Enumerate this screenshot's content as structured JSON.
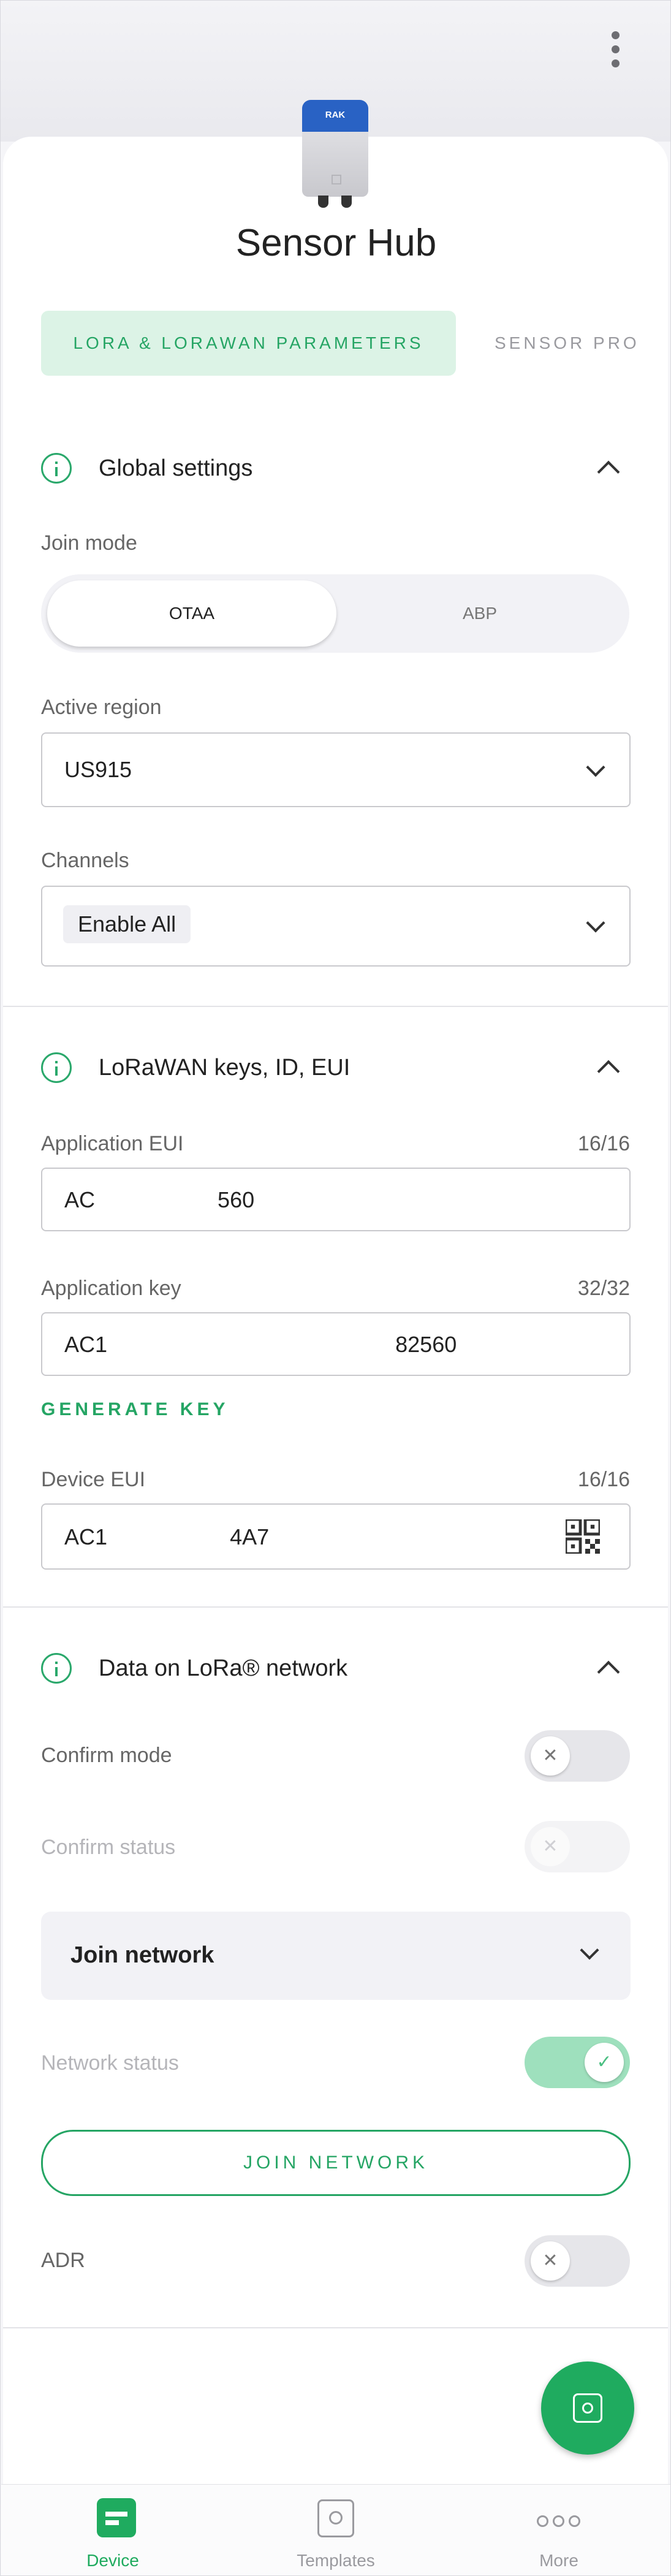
{
  "header": {
    "device_name": "Sensor Hub",
    "device_brand": "RAK"
  },
  "tabs": [
    {
      "label": "LORA & LORAWAN PARAMETERS",
      "active": true
    },
    {
      "label": "SENSOR PRO",
      "active": false
    }
  ],
  "global_settings": {
    "title": "Global settings",
    "join_mode_label": "Join mode",
    "join_mode_options": [
      "OTAA",
      "ABP"
    ],
    "join_mode_selected": "OTAA",
    "active_region_label": "Active region",
    "active_region_value": "US915",
    "channels_label": "Channels",
    "channels_value": "Enable All"
  },
  "keys": {
    "title": "LoRaWAN keys, ID, EUI",
    "app_eui_label": "Application EUI",
    "app_eui_count": "16/16",
    "app_eui_value": "AC                    560",
    "app_key_label": "Application key",
    "app_key_count": "32/32",
    "app_key_value": "AC1                                               82560",
    "generate_key": "GENERATE KEY",
    "dev_eui_label": "Device EUI",
    "dev_eui_count": "16/16",
    "dev_eui_value": "AC1                    4A7"
  },
  "network": {
    "title": "Data on LoRa® network",
    "confirm_mode_label": "Confirm mode",
    "confirm_mode_on": false,
    "confirm_status_label": "Confirm status",
    "confirm_status_on": false,
    "join_dropdown_label": "Join network",
    "network_status_label": "Network status",
    "network_status_on": true,
    "join_button": "JOIN NETWORK",
    "adr_label": "ADR",
    "adr_on": false
  },
  "bottom_nav": [
    {
      "label": "Device",
      "active": true
    },
    {
      "label": "Templates",
      "active": false
    },
    {
      "label": "More",
      "active": false
    }
  ],
  "colors": {
    "accent": "#1fab5f",
    "tab_bg": "#dcf3e6"
  },
  "icons": [
    "more-vertical-icon",
    "info-icon",
    "chevron-up-icon",
    "chevron-down-icon",
    "qr-code-icon",
    "close-icon",
    "check-icon",
    "fab-action-icon",
    "device-icon",
    "templates-icon",
    "more-icon"
  ]
}
